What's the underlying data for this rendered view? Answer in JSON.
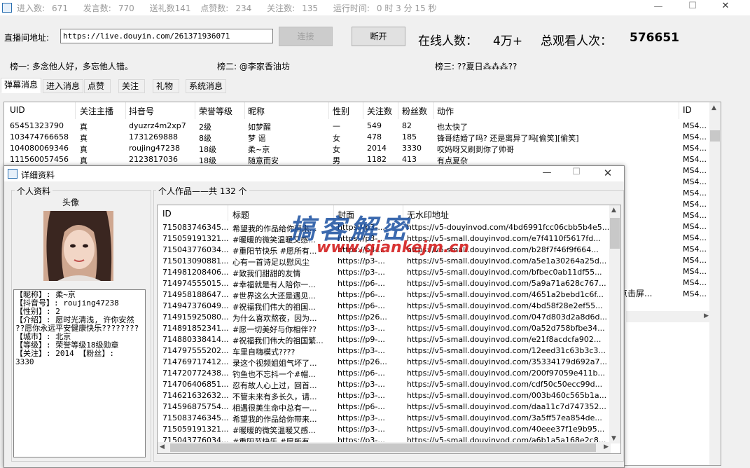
{
  "titlebar": {
    "stats": [
      "进入数:",
      "671",
      "发言数:",
      "770",
      "送礼数141",
      "点赞数:",
      "234",
      "关注数:",
      "135",
      "运行时间:",
      "0 时 3 分 15 秒"
    ]
  },
  "controls": {
    "url_label": "直播间地址:",
    "url_value": "https://live.douyin.com/261371936071",
    "connect_label": "连接",
    "disconnect_label": "断开",
    "online_label": "在线人数：",
    "online_value": "4万+",
    "total_label": "总观看人次：",
    "total_value": "576651"
  },
  "ranks": {
    "r1": "榜一: 多念他人好，多忘他人错。",
    "r2": "榜二: @李家香油坊",
    "r3": "榜三: ??夏日⁂⁂⁂??"
  },
  "tabs": [
    "弹幕消息",
    "进入消息",
    "点赞",
    "关注",
    "礼物",
    "系统消息"
  ],
  "grid": {
    "headers": [
      "UID",
      "关注主播",
      "抖音号",
      "荣誉等级",
      "昵称",
      "性别",
      "关注数",
      "粉丝数",
      "动作",
      "ID"
    ],
    "rows": [
      [
        "65451323790",
        "真",
        "dyuzrz4m2xp7",
        "2级",
        "如梦醒",
        "—",
        "549",
        "82",
        "也太快了",
        "MS4..."
      ],
      [
        "103474766658",
        "真",
        "1731269888",
        "8级",
        "梦  谣",
        "女",
        "478",
        "185",
        "锋哥结婚了吗? 还是离异了吗[偷笑][偷笑]",
        "MS4..."
      ],
      [
        "104080069346",
        "真",
        "roujing47238",
        "18级",
        "柔~京",
        "女",
        "2014",
        "3330",
        "哎妈呀又刷到你了帅哥",
        "MS4..."
      ],
      [
        "111560057456",
        "真",
        "2123817036",
        "18级",
        "随意而安",
        "男",
        "1182",
        "413",
        "有点夏杂",
        "MS4..."
      ]
    ],
    "id_column_rest": [
      "MS4...",
      "MS4...",
      "MS4...",
      "MS4...",
      "MS4...",
      "MS4...",
      "MS4...",
      "MS4...",
      "MS4...",
      "MS4...",
      "MS4...",
      "MS4..."
    ],
    "partial_action": "燧点击屏..."
  },
  "detail": {
    "title": "详细资料",
    "profile_group": "个人资料",
    "avatar_label": "头像",
    "info_lines": [
      "【昵称】: 柔~京",
      "【抖音号】: roujing47238",
      "【性别】: 2",
      "【介绍】: 愿时光清浅, 许你安然",
      "??愿你永远平安健康快乐????????",
      "【城市】: 北京",
      "【等级】: 荣誉等级18级勋章",
      "【关注】: 2014   【粉丝】:",
      "3330"
    ],
    "works_group": "个人作品——共 132 个",
    "works_headers": [
      "ID",
      "标题",
      "封面",
      "无水印地址"
    ],
    "works": [
      [
        "715083746345...",
        "希望我的作品给你带来...",
        "https://p3-...",
        "https://v5-douyinvod.com/4bd6991fcc06cbb5b4e5..."
      ],
      [
        "715059191321...",
        "#暖暖的微笑温暖又感...",
        "https://p3-...",
        "https://v5-small.douyinvod.com/e7f4110f5617fd..."
      ],
      [
        "715043776034...",
        "#重阳节快乐 #愿所有...",
        "https://p3-...",
        "https://v5-small.douyinvod.com/b28f7f46f9f664..."
      ],
      [
        "715013090881...",
        "心有一首诗足以慰风尘",
        "https://p3-...",
        "https://v5-small.douyinvod.com/a5e1a30264a25d..."
      ],
      [
        "714981208406...",
        "#致我们甜甜的友情",
        "https://p3-...",
        "https://v5-small.douyinvod.com/bfbec0ab11df55..."
      ],
      [
        "714974555015...",
        "#幸福就是有人陪你一...",
        "https://p6-...",
        "https://v5-small.douyinvod.com/5a9a71a628c767..."
      ],
      [
        "714958188647...",
        "#世界这么大还是遇见...",
        "https://p6-...",
        "https://v5-small.douyinvod.com/4651a2bebd1c6f..."
      ],
      [
        "714947376049...",
        "#祝福我们伟大的祖国...",
        "https://p6-...",
        "https://v5-small.douyinvod.com/4bd58f28e2ef55..."
      ],
      [
        "714915925080...",
        "为什么喜欢熬夜，因为...",
        "https://p26...",
        "https://v5-small.douyinvod.com/047d803d2a8d6d..."
      ],
      [
        "714891852341...",
        "#愿一切美好与你相伴??",
        "https://p3-...",
        "https://v5-small.douyinvod.com/0a52d758bfbe34..."
      ],
      [
        "714880338414...",
        "#祝福我们伟大的祖国繁...",
        "https://p9-...",
        "https://v5-small.douyinvod.com/e21f8acdcfa902..."
      ],
      [
        "714797555202...",
        "车里自嗨模式????",
        "https://p3-...",
        "https://v5-small.douyinvod.com/12eed31c63b3c3..."
      ],
      [
        "714769717412...",
        "录这个视频姐姐气坏了...",
        "https://p26...",
        "https://v5-small.douyinvod.com/35334179d692a7..."
      ],
      [
        "714720772438...",
        "钓鱼也不忘抖一个#帽...",
        "https://p6-...",
        "https://v5-small.douyinvod.com/200f97059e411b..."
      ],
      [
        "714706406851...",
        "忍有故人心上过，回首...",
        "https://p3-...",
        "https://v5-small.douyinvod.com/cdf50c50ecc99d..."
      ],
      [
        "714621632632...",
        "不管未来有多长久，请...",
        "https://p3-...",
        "https://v5-small.douyinvod.com/003b460c565b1a..."
      ],
      [
        "714596875754...",
        "相遇很美生命中总有一...",
        "https://p6-...",
        "https://v5-small.douyinvod.com/daa11c7d747352..."
      ],
      [
        "715083746345...",
        "希望我的作品给你带来...",
        "https://p3-...",
        "https://v5-small.douyinvod.com/3a5ff57ea854de..."
      ],
      [
        "715059191321...",
        "#暖暖的微笑温暖又感...",
        "https://p3-...",
        "https://v5-small.douyinvod.com/40eee37f1e9b95..."
      ],
      [
        "715043776034...",
        "#重阳节快乐 #愿所有...",
        "https://p3-...",
        "https://v5-small.douyinvod.com/a6b1a5a168e2c8..."
      ]
    ]
  },
  "watermark": {
    "cn": "搞客解密",
    "url": "www.qiankejm.cn"
  },
  "colors": {
    "accent": "#1a4fa0",
    "watermark_red": "#d42020"
  }
}
